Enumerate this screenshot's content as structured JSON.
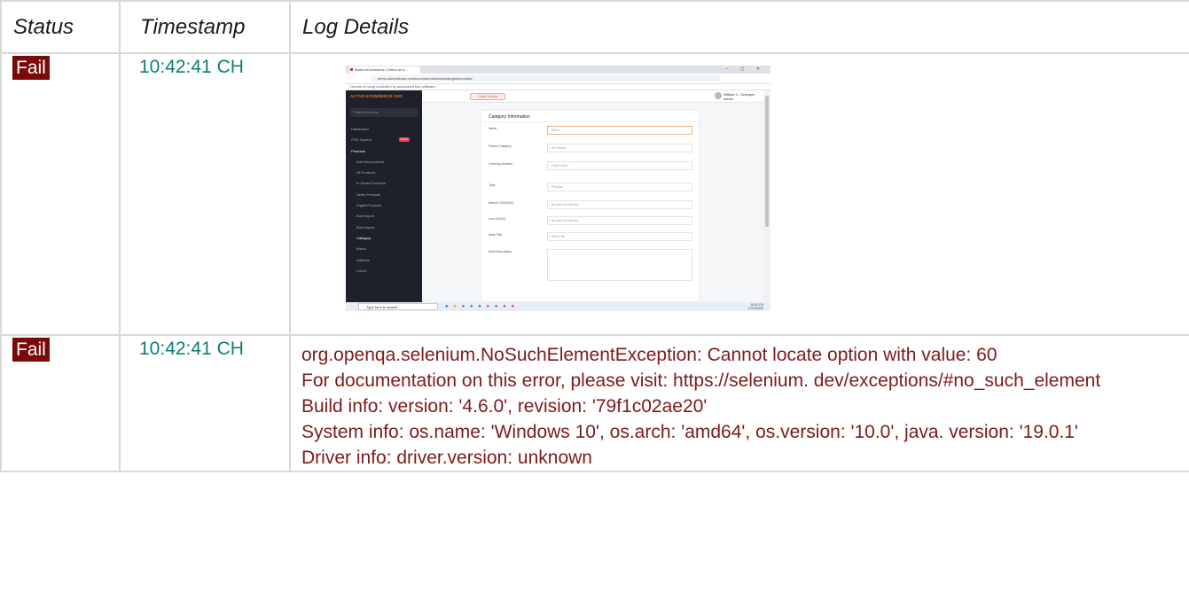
{
  "table": {
    "headers": {
      "status": "Status",
      "timestamp": "Timestamp",
      "details": "Log Details"
    },
    "rows": [
      {
        "status": "Fail",
        "timestamp": "10:42:41 CH",
        "details_type": "screenshot"
      },
      {
        "status": "Fail",
        "timestamp": "10:42:41 CH",
        "details_type": "text",
        "lines": [
          "org.openqa.selenium.NoSuchElementException: Cannot locate option with value: 60",
          "For documentation on this error, please visit: https://selenium. dev/exceptions/#no_such_element",
          "Build info: version: '4.6.0', revision: '79f1c02ae20'",
          "System info: os.name: 'Windows 10', os.arch: 'amd64', os.version: '10.0', java. version: '19.0.1'",
          "Driver info: driver.version: unknown"
        ]
      }
    ]
  },
  "screenshot": {
    "tab_title": "Active eCommerce | Demo of in...",
    "url": "demo.activeitzone.com/ecommerce/admin/categories/create",
    "infobar": "Chrome is being controlled by automated test software.",
    "window_controls": "– ▢ ✕",
    "brand": "ACTIVE ECOMMERCE CMS",
    "search_placeholder": "Search in menu",
    "menu": [
      "Dashboard",
      "POS System",
      "Products",
      "Add New product",
      "All Products",
      "In House Products",
      "Seller Products",
      "Digital Products",
      "Bulk Import",
      "Bulk Export",
      "Category",
      "Brand",
      "Attribute",
      "Colors"
    ],
    "menu_badge": "Addon",
    "clear_cache": "Clear Cache",
    "user_name": "William C. Schrayer",
    "user_role": "admin",
    "card_title": "Category Information",
    "fields": [
      {
        "label": "Name",
        "value": "Name"
      },
      {
        "label": "Parent Category",
        "value": "No Parent"
      },
      {
        "label": "Ordering Number",
        "value": "Order Level"
      },
      {
        "label": "Type",
        "value": "Physical"
      },
      {
        "label": "Banner (200x200)",
        "value": "Browse   Choose file"
      },
      {
        "label": "Icon (32x32)",
        "value": "Browse   Choose file"
      },
      {
        "label": "Meta Title",
        "value": "Meta Title"
      },
      {
        "label": "Meta Description",
        "value": ""
      }
    ],
    "taskbar_search": "Type here to search",
    "tray_time": "10:42 CH",
    "tray_date": "17/01/2023"
  }
}
